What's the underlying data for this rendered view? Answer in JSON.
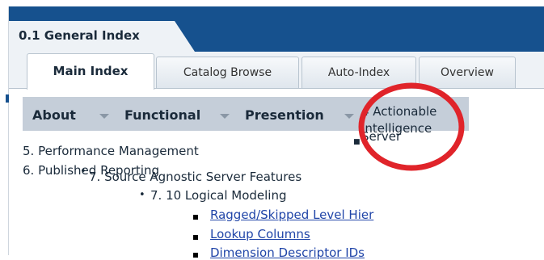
{
  "window": {
    "title": "0.1 General Index"
  },
  "tabs": [
    {
      "label": "Main Index",
      "active": true
    },
    {
      "label": "Catalog Browse",
      "active": false
    },
    {
      "label": "Auto-Index",
      "active": false
    },
    {
      "label": "Overview",
      "active": false
    }
  ],
  "nav": {
    "items": [
      {
        "label": "About"
      },
      {
        "label": "Functional"
      },
      {
        "label": "Presention"
      }
    ],
    "actionable_line1": "4 Actionable",
    "actionable_line2": "Intelligence",
    "server_label": "Server"
  },
  "content": {
    "item5": "5. Performance Management",
    "item6": "6. Published Reporting",
    "item7": "7. Source Agnostic Server Features",
    "item7_10": "7. 10 Logical Modeling",
    "links": [
      "Ragged/Skipped Level Hier",
      "Lookup Columns",
      "Dimension Descriptor IDs"
    ]
  },
  "colors": {
    "title_bar": "#16518e",
    "nav_bar": "#c5ced9",
    "link": "#2045a8",
    "annotation_circle": "#e0242a"
  },
  "icons": [
    "chevron-down-icon",
    "circle-annotation"
  ]
}
